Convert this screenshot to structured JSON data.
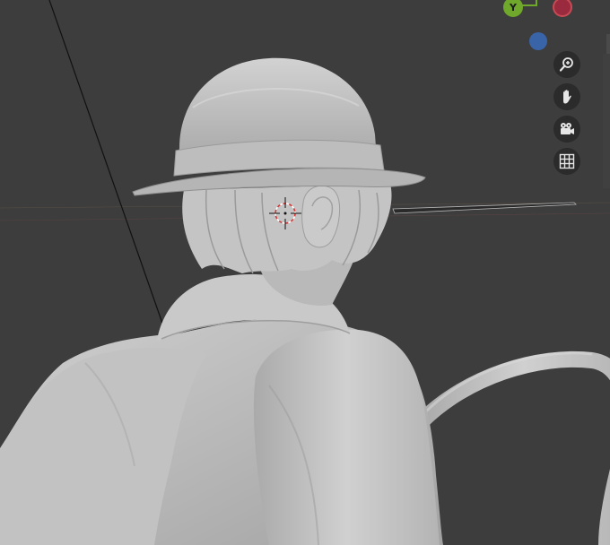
{
  "app": {
    "view": "3D Viewport"
  },
  "gizmo": {
    "y_label": "Y",
    "colors": {
      "y": "#6fa82a",
      "x_neg": "#9a2b3e",
      "z_neg": "#3a64a8"
    }
  },
  "navigation": {
    "buttons": [
      {
        "name": "zoom",
        "icon": "magnifier-plus-icon"
      },
      {
        "name": "pan",
        "icon": "hand-icon"
      },
      {
        "name": "camera",
        "icon": "camera-icon"
      },
      {
        "name": "ortho-toggle",
        "icon": "grid-icon"
      }
    ]
  },
  "scene": {
    "background_color": "#3d3d3d",
    "model_color": "#c6c6c6"
  }
}
